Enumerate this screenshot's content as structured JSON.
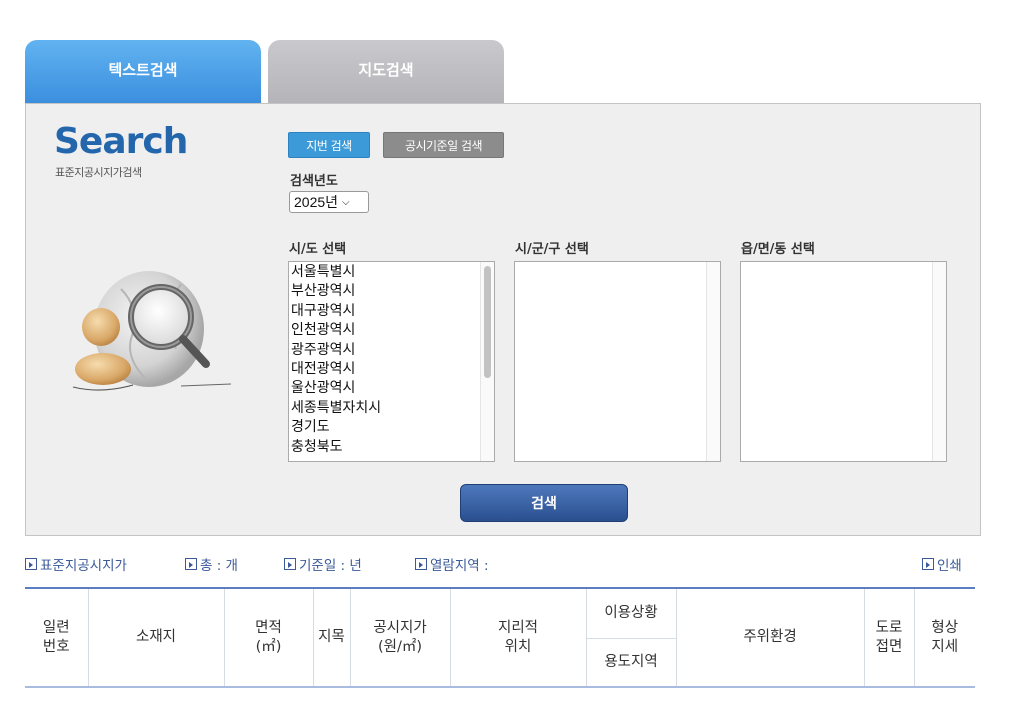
{
  "tabs": [
    {
      "label": "텍스트검색",
      "active": true
    },
    {
      "label": "지도검색",
      "active": false
    }
  ],
  "logo": {
    "title": "Search",
    "subtitle": "표준지공시지가검색"
  },
  "mode_buttons": {
    "jibun": "지번 검색",
    "date": "공시기준일 검색"
  },
  "year": {
    "label": "검색년도",
    "selected": "2025년"
  },
  "region": {
    "sido_label": "시/도 선택",
    "sigungu_label": "시/군/구 선택",
    "eupmyeondong_label": "읍/면/동 선택",
    "sido_options": [
      "서울특별시",
      "부산광역시",
      "대구광역시",
      "인천광역시",
      "광주광역시",
      "대전광역시",
      "울산광역시",
      "세종특별자치시",
      "경기도",
      "충청북도"
    ]
  },
  "search_button": "검색",
  "info": {
    "standard_price": "표준지공시지가",
    "total": "총 : 개",
    "base_date": "기준일 : 년",
    "region": "열람지역 :",
    "print": "인쇄"
  },
  "table": {
    "serial": [
      "일련",
      "번호"
    ],
    "location": "소재지",
    "area": [
      "면적",
      "(㎡)"
    ],
    "land_category": "지목",
    "price": [
      "공시지가",
      "(원/㎡)"
    ],
    "geo_position": [
      "지리적",
      "위치"
    ],
    "usage_status": "이용상황",
    "zoning": "용도지역",
    "surroundings": "주위환경",
    "road": [
      "도로",
      "접면"
    ],
    "shape": [
      "형상",
      "지세"
    ]
  },
  "colors": {
    "tab_active": "#3b8fde",
    "tab_inactive": "#b4b4b9",
    "accent": "#2466ab",
    "search_button": "#2a4f8f"
  }
}
